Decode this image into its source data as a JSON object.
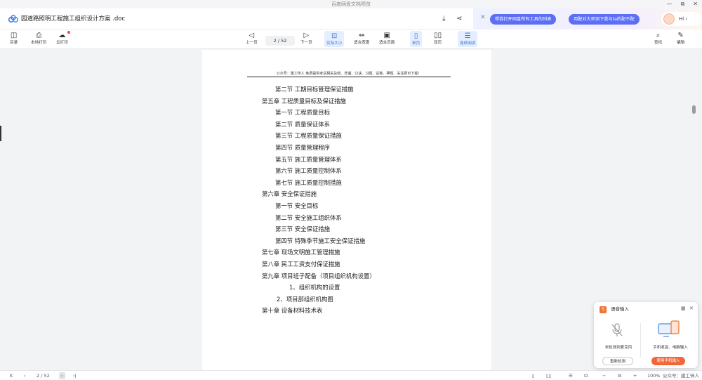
{
  "window": {
    "title": "百度网盘文档预览",
    "controls": [
      "—",
      "⧉",
      "✕"
    ]
  },
  "titlebar": {
    "doc_title": "园道路照明工程施工组织设计方案 .doc",
    "download_icon": "download-icon",
    "share_icon": "share-icon"
  },
  "banner": {
    "close": "✕",
    "pill1": "帮我打开网盘所有工具的列表",
    "pill2": "用配对大师测下我与ta的配不配",
    "hi": "Hi ›"
  },
  "toolbar": {
    "left": [
      {
        "icon": "◫",
        "label": "目录"
      },
      {
        "icon": "⎙",
        "label": "本地打印"
      },
      {
        "icon": "☁",
        "label": "云打印"
      }
    ],
    "prev_label": "上一页",
    "page_indicator": "2  /  52",
    "next_label": "下一页",
    "view_actual": "实际大小",
    "view_width": "适合宽度",
    "view_page": "适合页面",
    "single": "单页",
    "double": "双页",
    "continuous": "连续阅读",
    "search": "查找",
    "edit": "编辑"
  },
  "document": {
    "header": "公众号：建工伴人   免费提供考试相关总结、背诵、口诀、习题、试卷、押题、关注即可下载！",
    "toc": [
      {
        "text": "第二节    工期目标管理保证措施",
        "indent": 2
      },
      {
        "text": "第五章    工程质量目标及保证措施",
        "indent": 1
      },
      {
        "text": "第一节    工程质量目标",
        "indent": 2
      },
      {
        "text": "第二节    质量保证体系",
        "indent": 2
      },
      {
        "text": "第三节    工程质量保证措施",
        "indent": 2
      },
      {
        "text": "第四节    质量管理程序",
        "indent": 2
      },
      {
        "text": "第五节    施工质量管理体系",
        "indent": 2
      },
      {
        "text": "第六节    施工质量控制体系",
        "indent": 2
      },
      {
        "text": "第七节    施工质量控制措施",
        "indent": 2
      },
      {
        "text": "第六章    安全保证措施",
        "indent": 1
      },
      {
        "text": "第一节    安全目标",
        "indent": 2
      },
      {
        "text": "第二节    安全施工组织体系",
        "indent": 2
      },
      {
        "text": "第三节    安全保证措施",
        "indent": 2
      },
      {
        "text": "第四节    特殊季节施工安全保证措施",
        "indent": 2
      },
      {
        "text": "第七章    现场文明施工管理措施",
        "indent": 1
      },
      {
        "text": "第八章    民工工资支付保证措施",
        "indent": 1
      },
      {
        "text": "第九章    项目班子配备（项目组织机构设置）",
        "indent": 1
      },
      {
        "text": "1、组织机构的设置",
        "indent": 3
      },
      {
        "text": "2、项目部组织机构图",
        "indent": 4
      },
      {
        "text": "第十章    设备材料技术表",
        "indent": 1
      }
    ]
  },
  "bottombar": {
    "first": "K",
    "prev": "‹",
    "page": "2 / 52",
    "next": "›",
    "last": "›|",
    "zoom": "100%",
    "watermark": "公众号：建工伴人"
  },
  "voice_panel": {
    "title": "语音输入",
    "logo": "S",
    "grid_icon": "▦",
    "close": "✕",
    "left_label": "未检测到麦克风",
    "right_label": "手机收音、电脑输入",
    "left_button": "重新检测",
    "right_button": "使用手机输入"
  }
}
